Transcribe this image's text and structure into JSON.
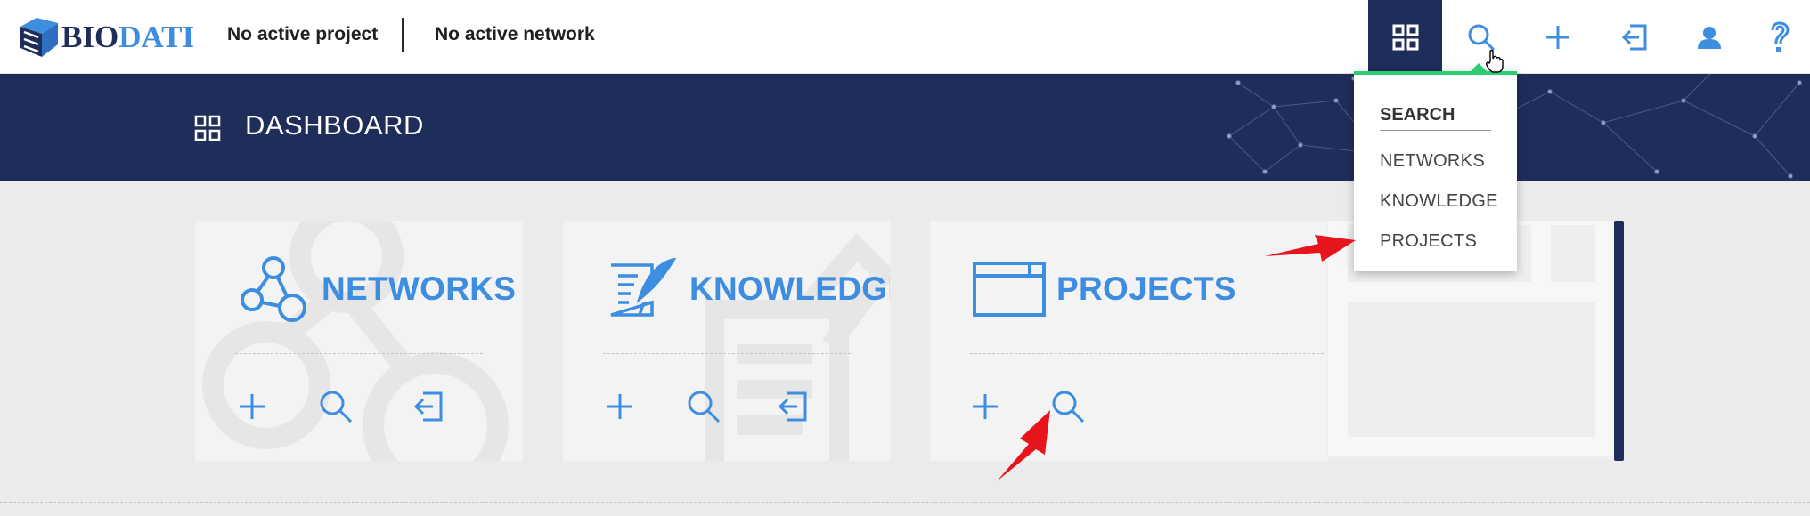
{
  "app": {
    "logo_part1": "BIO",
    "logo_part2": "DATI",
    "active_project": "No active project",
    "active_network": "No active network"
  },
  "nav": {
    "icons": [
      "dashboard-icon",
      "search-icon",
      "plus-icon",
      "import-icon",
      "user-icon",
      "help-icon"
    ],
    "active": "dashboard"
  },
  "header": {
    "title": "DASHBOARD"
  },
  "cards": [
    {
      "title": "NETWORKS",
      "actions": [
        "plus-icon",
        "search-icon",
        "import-icon"
      ]
    },
    {
      "title": "KNOWLEDGE",
      "actions": [
        "plus-icon",
        "search-icon",
        "import-icon"
      ]
    },
    {
      "title": "PROJECTS",
      "actions": [
        "plus-icon",
        "search-icon"
      ]
    }
  ],
  "search_menu": {
    "heading": "SEARCH",
    "items": [
      "NETWORKS",
      "KNOWLEDGE",
      "PROJECTS"
    ]
  },
  "colors": {
    "navy": "#1f2d5a",
    "accent_blue": "#3d8de0",
    "dropdown_accent": "#2ecc71",
    "annotation_red": "#e8141b"
  }
}
